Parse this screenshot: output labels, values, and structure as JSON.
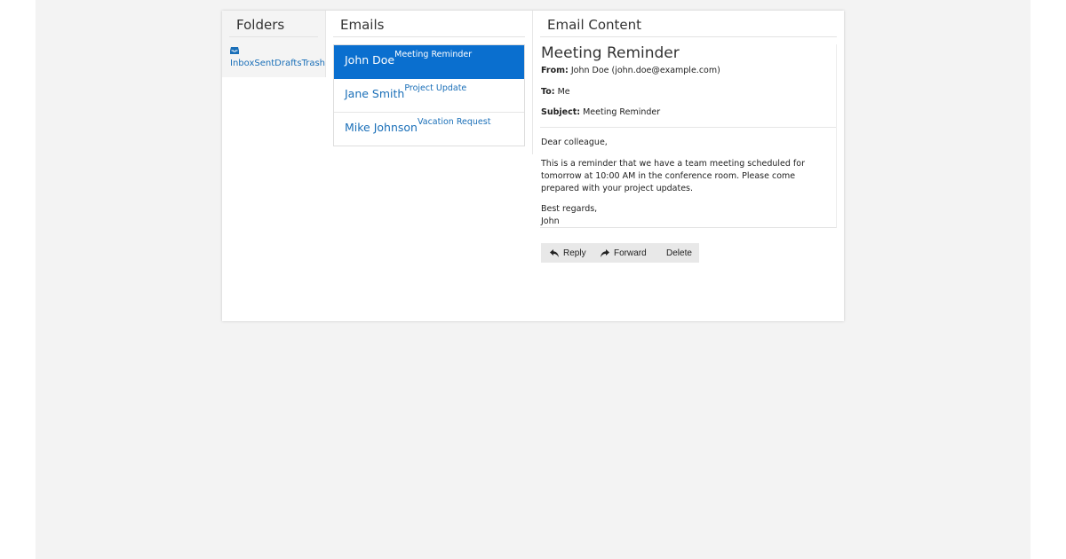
{
  "folders": {
    "title": "Folders",
    "items": [
      "Inbox",
      "Sent",
      "Drafts",
      "Trash"
    ]
  },
  "emails": {
    "title": "Emails",
    "items": [
      {
        "sender": "John Doe",
        "subject": "Meeting Reminder",
        "active": true
      },
      {
        "sender": "Jane Smith",
        "subject": "Project Update",
        "active": false
      },
      {
        "sender": "Mike Johnson",
        "subject": "Vacation Request",
        "active": false
      }
    ]
  },
  "content": {
    "title": "Email Content",
    "subject": "Meeting Reminder",
    "from_label": "From:",
    "from_value": "John Doe (john.doe@example.com)",
    "to_label": "To:",
    "to_value": "Me",
    "subject_label": "Subject:",
    "subject_value": "Meeting Reminder",
    "greeting": "Dear colleague,",
    "body": "This is a reminder that we have a team meeting scheduled for tomorrow at 10:00 AM in the conference room. Please come prepared with your project updates.",
    "signoff": "Best regards,",
    "signature": "John"
  },
  "actions": {
    "reply": "Reply",
    "forward": "Forward",
    "delete": "Delete"
  },
  "colors": {
    "accent": "#0a6fcf",
    "link": "#1a6fb8",
    "background": "#f3f3f3"
  },
  "icons": {
    "folder": "inbox-icon",
    "reply": "reply-icon",
    "forward": "forward-icon"
  }
}
